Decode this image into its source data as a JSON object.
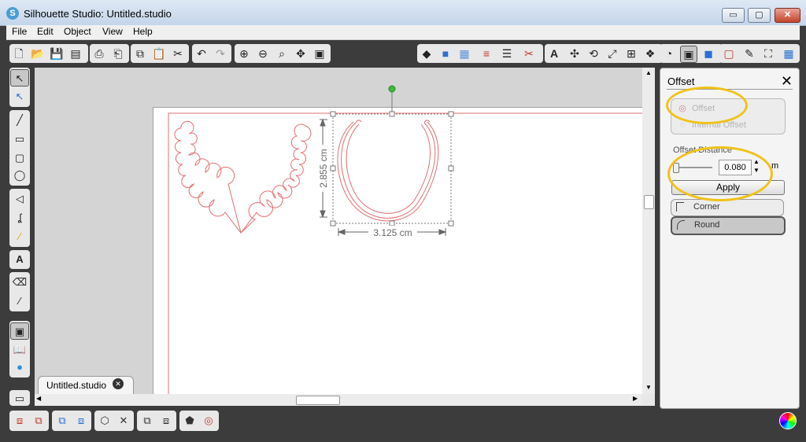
{
  "window": {
    "title": "Silhouette Studio: Untitled.studio",
    "minimize": "▭",
    "maximize": "▢",
    "close": "✕"
  },
  "menu": [
    "File",
    "Edit",
    "Object",
    "View",
    "Help"
  ],
  "document_tab": {
    "label": "Untitled.studio",
    "close_icon": "✕"
  },
  "canvas": {
    "width_dimension": "3.125 cm",
    "height_dimension": "2.855 cm",
    "shape_color": "#e26f6f",
    "selection_rotate_handle_color": "#3cba3c"
  },
  "offset_panel": {
    "title": "Offset",
    "close_icon": "✕",
    "options": [
      "Offset",
      "Internal Offset"
    ],
    "distance_label": "Offset Distance",
    "distance_value": "0.080",
    "unit": "m",
    "apply_label": "Apply",
    "corner_label": "Corner",
    "round_label": "Round",
    "slider_level": 0.0
  },
  "highlight_color": "#f0c21a",
  "icons": {
    "toolbar": [
      "new-file-icon",
      "open-file-icon",
      "save-icon",
      "save-sd-icon",
      "print-icon",
      "send-to-cutter-icon",
      "copy-icon",
      "paste-icon",
      "cut-icon",
      "undo-icon",
      "redo-icon",
      "zoom-in-icon",
      "zoom-out-icon",
      "zoom-select-icon",
      "pan-icon",
      "fit-page-icon",
      "fill-color-icon",
      "line-color-icon",
      "fill-pattern-icon",
      "line-style-icon",
      "text-style-icon",
      "knife-icon",
      "text-icon",
      "transform-icon",
      "rotate-icon",
      "scale-icon",
      "align-icon",
      "replicate-icon",
      "page-setup-icon",
      "offset-panel-icon",
      "trace-icon",
      "cut-settings-icon",
      "draw-icon",
      "fullscreen-icon",
      "grid-icon"
    ]
  }
}
